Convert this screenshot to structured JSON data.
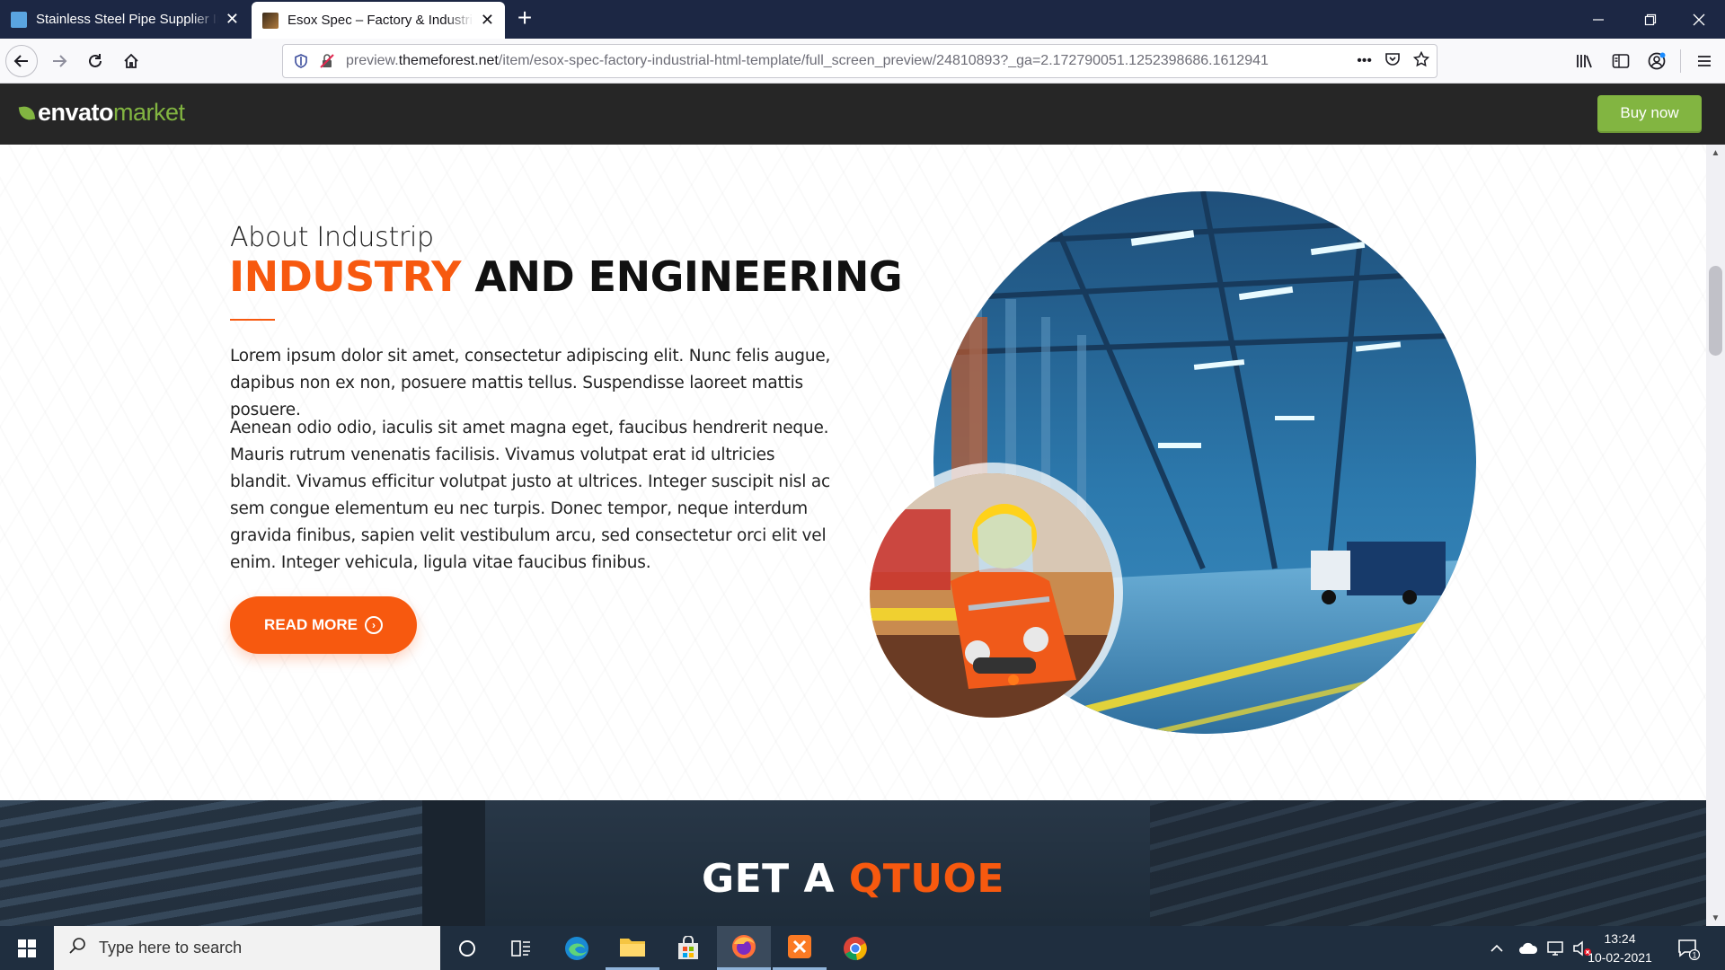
{
  "browser": {
    "tabs": [
      {
        "title": "Stainless Steel Pipe Supplier In",
        "active": false
      },
      {
        "title": "Esox Spec – Factory & Industrial",
        "active": true
      }
    ],
    "url": {
      "prefix": "preview.",
      "domain": "themeforest.net",
      "path": "/item/esox-spec-factory-industrial-html-template/full_screen_preview/24810893?_ga=2.172790051.1252398686.1612941"
    },
    "url_more": "•••"
  },
  "envato": {
    "logo_word": "envato",
    "logo_market": "market",
    "buy_label": "Buy now"
  },
  "about": {
    "eyebrow": "About Industrip",
    "headline_accent": "INDUSTRY",
    "headline_rest": " AND ENGINEERING",
    "para1": "Lorem ipsum dolor sit amet, consectetur adipiscing elit. Nunc felis augue, dapibus non ex non, posuere mattis tellus. Suspendisse laoreet mattis posuere.",
    "para2": "Aenean odio odio, iaculis sit amet magna eget, faucibus hendrerit neque. Mauris rutrum venenatis facilisis. Vivamus volutpat erat id ultricies blandit. Vivamus efficitur volutpat justo at ultrices. Integer suscipit nisl ac sem congue elementum eu nec turpis. Donec tempor, neque interdum gravida finibus, sapien velit vestibulum arcu, sed consectetur orci elit vel enim. Integer vehicula, ligula vitae faucibus finibus.",
    "button_label": "READ MORE"
  },
  "quote": {
    "title_plain": "GET A ",
    "title_accent": "QTUOE"
  },
  "taskbar": {
    "search_placeholder": "Type here to search",
    "time": "13:24",
    "date": "10-02-2021",
    "notification_count": "1"
  },
  "colors": {
    "accent": "#f7590f",
    "envato_green": "#82b541",
    "tabstrip": "#1c2744",
    "taskbar": "#1f2e3f"
  },
  "icons": [
    "back-icon",
    "forward-icon",
    "reload-icon",
    "home-icon",
    "shield-icon",
    "insecure-lock-icon",
    "more-icon",
    "pocket-icon",
    "star-icon",
    "library-icon",
    "sidebar-icon",
    "account-icon",
    "menu-icon",
    "windows-start-icon",
    "search-icon",
    "cortana-icon",
    "task-view-icon",
    "edge-icon",
    "file-explorer-icon",
    "store-icon",
    "firefox-icon",
    "xampp-icon",
    "chrome-icon",
    "chevron-up-icon",
    "cloud-icon",
    "network-icon",
    "volume-muted-icon",
    "notification-icon"
  ]
}
